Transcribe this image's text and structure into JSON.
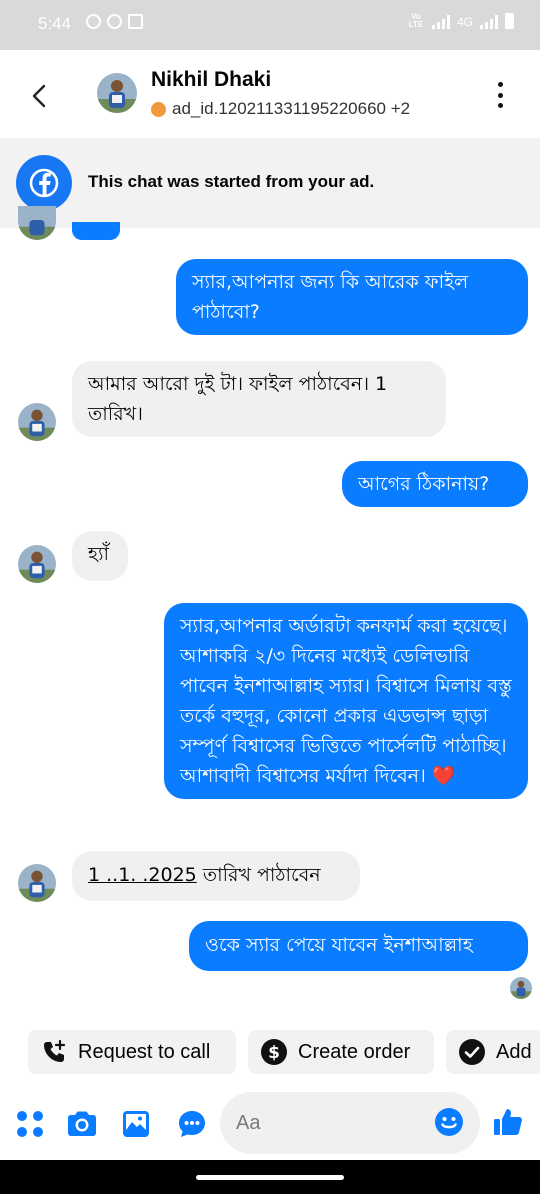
{
  "status_bar": {
    "time": "5:44",
    "volte": "Vo LTE",
    "network": "4G"
  },
  "header": {
    "name": "Nikhil Dhaki",
    "subtitle": "ad_id.120211331195220660 +2"
  },
  "ad_banner": {
    "text": "This chat was started from your ad."
  },
  "messages": [
    {
      "direction": "out",
      "text": "স্যার,আপনার জন্য কি আরেক ফাইল পাঠাবো?"
    },
    {
      "direction": "in",
      "text": "আমার আরো দুই টা। ফাইল পাঠাবেন। 1 তারিখ।"
    },
    {
      "direction": "out",
      "text": "আগের ঠিকানায়?"
    },
    {
      "direction": "in",
      "text": "হ্যাঁ"
    },
    {
      "direction": "out",
      "text": "স্যার,আপনার অর্ডারটা কনফার্ম করা হয়েছে। আশাকরি ২/৩ দিনের মধ্যেই ডেলিভারি পাবেন ইনশাআল্লাহ স্যার। বিশ্বাসে মিলায় বস্তু তর্কে বহুদূর, কোনো প্রকার এডভান্স ছাড়া সম্পূর্ণ বিশ্বাসের ভিত্তিতে পার্সেলটি পাঠাচ্ছি।আশাবাদী বিশ্বাসের মর্যাদা দিবেন।",
      "emoji": "❤️"
    },
    {
      "direction": "in",
      "link_text": "1 ..1. .2025",
      "text": " তারিখ পাঠাবেন"
    },
    {
      "direction": "out",
      "text": "ওকে স্যার পেয়ে যাবেন ইনশাআল্লাহ"
    }
  ],
  "quick_actions": [
    {
      "label": "Request to call",
      "icon": "phone-add-icon"
    },
    {
      "label": "Create order",
      "icon": "dollar-icon"
    },
    {
      "label": "Add",
      "icon": "check-circle-icon"
    }
  ],
  "composer": {
    "placeholder": "Aa"
  },
  "colors": {
    "accent": "#0a7cff",
    "incoming_bubble": "#f0f0f0",
    "status_bar": "#d9d9d9",
    "ad_dot": "#f0993a"
  }
}
